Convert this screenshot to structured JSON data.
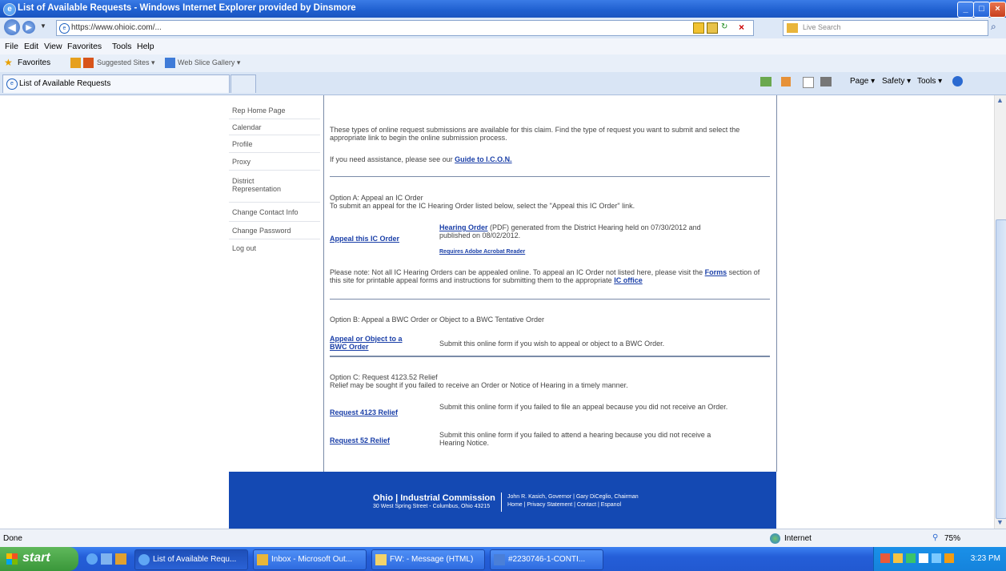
{
  "window": {
    "title": "List of Available Requests - Windows Internet Explorer provided by Dinsmore",
    "minimize": "_",
    "maximize": "□",
    "close": "×"
  },
  "address_bar": {
    "url": "https://www.ohioic.com/...",
    "search_placeholder": "Live Search"
  },
  "menu": [
    "File",
    "Edit",
    "View",
    "Favorites",
    "Tools",
    "Help"
  ],
  "favorites_bar": {
    "favorites": "Favorites",
    "suggested_sites": "Suggested Sites ▾",
    "web_slice_gallery": "Web Slice Gallery ▾"
  },
  "tabs": [
    {
      "label": "List of Available Requests"
    }
  ],
  "command_bar": {
    "page": "Page ▾",
    "safety": "Safety ▾",
    "tools": "Tools ▾"
  },
  "left_nav": [
    "Rep Home Page",
    "Calendar",
    "Profile",
    "Proxy",
    "District Representation",
    "Change Contact Info",
    "Change Password",
    "Log out"
  ],
  "main": {
    "intro": "These types of online request submissions are available for this claim. Find the type of request you want to submit and select the appropriate link to begin the online submission process.",
    "assist_text": "If you need assistance, please see our",
    "assist_link": "Guide to I.C.O.N.",
    "option_a": {
      "heading": "Option A: Appeal an IC Order",
      "desc": "To submit an appeal for the IC Hearing Order listed below, select the \"Appeal this IC Order\" link.",
      "link": "Appeal this IC Order",
      "order_link": "Hearing Order",
      "order_text": "(PDF) generated from the District Hearing held on 07/30/2012 and published on 08/02/2012.",
      "adobe_link": "Requires Adobe Acrobat Reader",
      "note": "Please note: Not all IC Hearing Orders can be appealed online. To appeal an IC Order not listed here, please visit the",
      "forms_link": "Forms",
      "note2": "section of this site for printable appeal forms and instructions for submitting them to the appropriate",
      "office_link": "IC office"
    },
    "option_b": {
      "heading": "Option B: Appeal a BWC Order or Object to a BWC Tentative Order",
      "link": "Appeal or Object to a BWC Order",
      "desc": "Submit this online form if you wish to appeal or object to a BWC Order."
    },
    "option_c": {
      "heading": "Option C: Request 4123.52 Relief",
      "desc": "Relief may be sought if you failed to receive an Order or Notice of Hearing in a timely manner.",
      "link1": "Request 4123 Relief",
      "desc1": "Submit this online form if you failed to file an appeal because you did not receive an Order.",
      "link2": "Request 52 Relief",
      "desc2": "Submit this online form if you failed to attend a hearing because you did not receive a Hearing Notice."
    }
  },
  "footer": {
    "org": "Ohio | Industrial Commission",
    "address": "30 West Spring Street - Columbus, Ohio 43215",
    "line1": "John R. Kasich, Governor | Gary DiCeglio, Chairman",
    "line2": "Home | Privacy Statement | Contact | Espanol"
  },
  "status_bar": {
    "status": "Done",
    "zone": "Internet",
    "zoom": "75%"
  },
  "taskbar": {
    "start": "start",
    "items": [
      "List of Available Requ...",
      "Inbox - Microsoft Out...",
      "FW: - Message (HTML)",
      "#2230746-1-CONTI..."
    ],
    "clock": "3:23 PM"
  }
}
